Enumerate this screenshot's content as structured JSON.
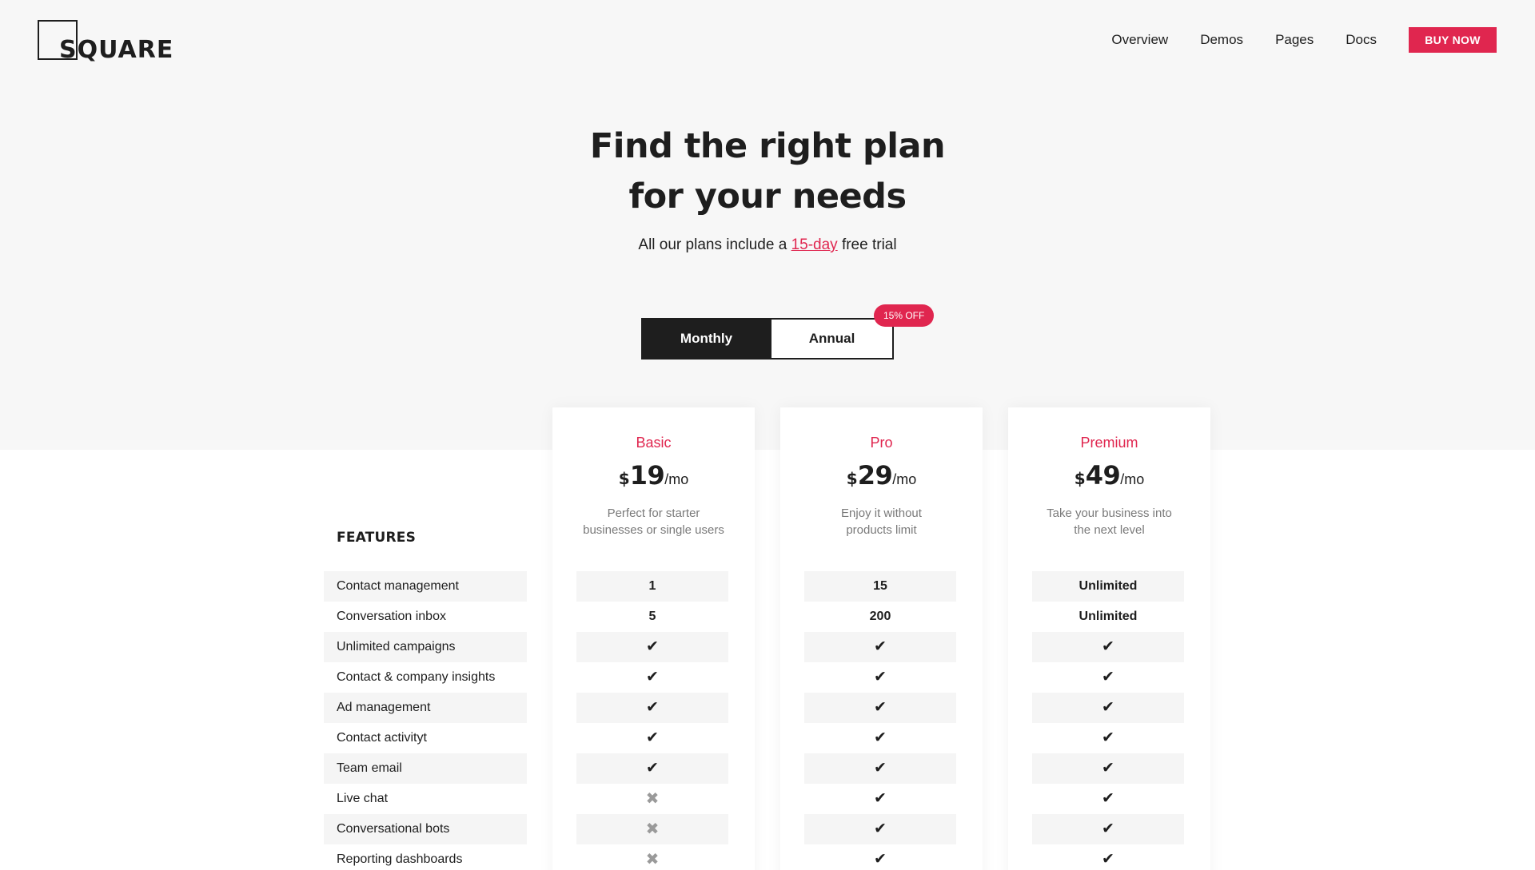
{
  "header": {
    "logo_text": "SQUARE",
    "nav": [
      "Overview",
      "Demos",
      "Pages",
      "Docs"
    ],
    "cta_label": "BUY NOW"
  },
  "hero": {
    "title_line1": "Find the right plan",
    "title_line2": "for your needs",
    "subtitle_before": "All our plans include a ",
    "subtitle_link": "15-day",
    "subtitle_after": " free trial"
  },
  "billing_toggle": {
    "monthly_label": "Monthly",
    "annual_label": "Annual",
    "selected": "Monthly",
    "discount_badge": "15% OFF"
  },
  "features_heading": "FEATURES",
  "features": [
    "Contact management",
    "Conversation inbox",
    "Unlimited campaigns",
    "Contact & company insights",
    "Ad management",
    "Contact activityt",
    "Team email",
    "Live chat",
    "Conversational bots",
    "Reporting dashboards"
  ],
  "plans": [
    {
      "name": "Basic",
      "currency": "$",
      "amount": "19",
      "period": "/mo",
      "desc_line1": "Perfect for starter",
      "desc_line2": "businesses or single users",
      "values": [
        "1",
        "5",
        "check",
        "check",
        "check",
        "check",
        "check",
        "cross",
        "cross",
        "cross"
      ]
    },
    {
      "name": "Pro",
      "currency": "$",
      "amount": "29",
      "period": "/mo",
      "desc_line1": "Enjoy it without",
      "desc_line2": "products limit",
      "values": [
        "15",
        "200",
        "check",
        "check",
        "check",
        "check",
        "check",
        "check",
        "check",
        "check"
      ]
    },
    {
      "name": "Premium",
      "currency": "$",
      "amount": "49",
      "period": "/mo",
      "desc_line1": "Take your business into",
      "desc_line2": "the next level",
      "values": [
        "Unlimited",
        "Unlimited",
        "check",
        "check",
        "check",
        "check",
        "check",
        "check",
        "check",
        "check"
      ]
    }
  ],
  "colors": {
    "accent": "#e0264f",
    "dark": "#1e1e1e",
    "hero_bg": "#f7f7f7",
    "stripe": "#f5f5f5",
    "muted": "#7a7a7a"
  },
  "icons": {
    "check": "check-icon",
    "cross": "cross-icon"
  }
}
